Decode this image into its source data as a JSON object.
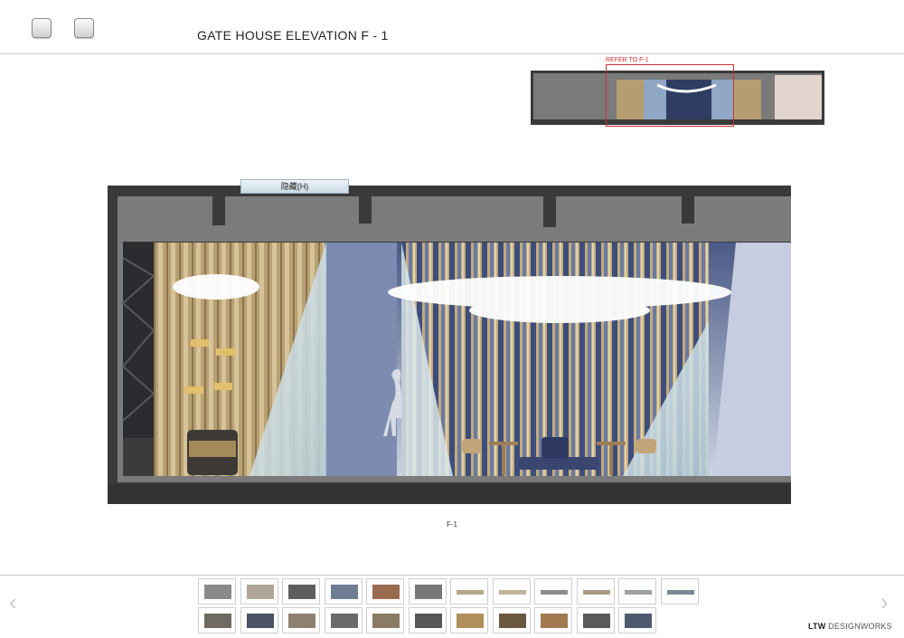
{
  "toolbar": {
    "buttons": [
      {
        "icon": "square-button-icon"
      },
      {
        "icon": "square-button-icon"
      }
    ]
  },
  "page": {
    "title": "GATE HOUSE ELEVATION F - 1",
    "refer_label": "REFER TO F-1",
    "hide_button_label": "隐藏(H)",
    "caption": "F-1"
  },
  "navigation": {
    "prev_icon": "chevron-left-icon",
    "next_icon": "chevron-right-icon",
    "prev_glyph": "‹",
    "next_glyph": "›"
  },
  "thumbnails": {
    "row1_count": 12,
    "row2_count": 11
  },
  "brand": {
    "strong": "LTW",
    "rest": " DESIGNWORKS"
  },
  "colors": {
    "frame": "#3a3a3a",
    "ceiling": "#7b7b7b",
    "wall_gold": "#b39a6e",
    "wall_blue": "#4b5a86",
    "glass": "#c9dbe4",
    "highlight_red": "#d03030"
  }
}
